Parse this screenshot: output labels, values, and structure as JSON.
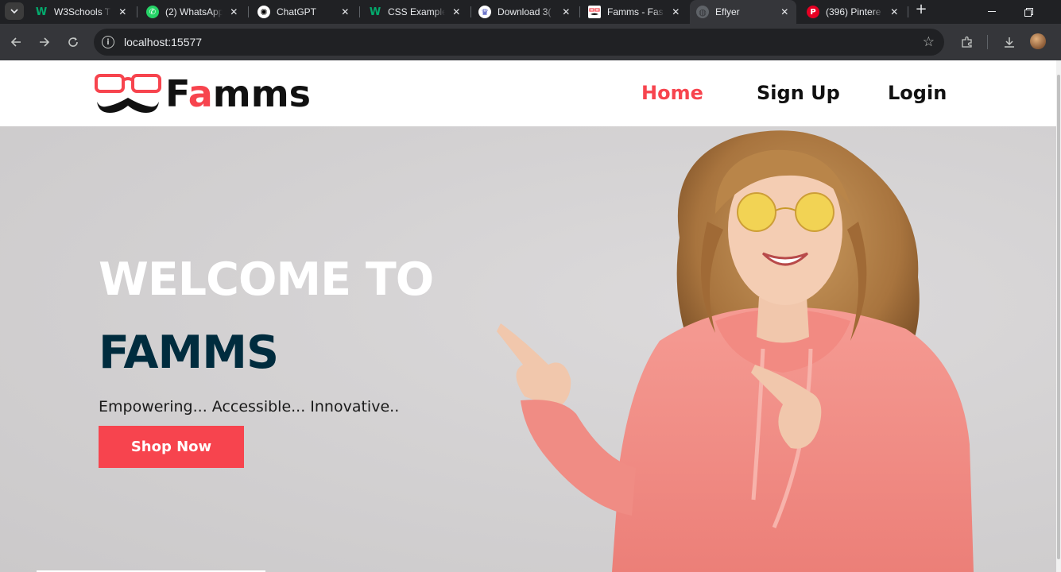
{
  "browser": {
    "tabs": [
      {
        "title": "W3Schools T",
        "favicon_color": "#04aa6d",
        "favicon_glyph": "W"
      },
      {
        "title": "(2) WhatsApp",
        "favicon_color": "#25d366",
        "favicon_glyph": "✆"
      },
      {
        "title": "ChatGPT",
        "favicon_color": "#ffffff",
        "favicon_glyph": "✺"
      },
      {
        "title": "CSS Example",
        "favicon_color": "#04aa6d",
        "favicon_glyph": "W"
      },
      {
        "title": "Download 3(",
        "favicon_color": "#5b5fc7",
        "favicon_glyph": "♛"
      },
      {
        "title": "Famms - Fas",
        "favicon_color": "#f7444e",
        "favicon_glyph": "◡"
      },
      {
        "title": "Eflyer",
        "favicon_color": "#5f6368",
        "favicon_glyph": "◍"
      },
      {
        "title": "(396) Pintere",
        "favicon_color": "#e60023",
        "favicon_glyph": "P"
      }
    ],
    "active_tab_index": 6,
    "url": "localhost:15577"
  },
  "site": {
    "logo": {
      "letters": [
        "F",
        "a",
        "mms"
      ],
      "accent_color": "#f7444e"
    },
    "nav": [
      {
        "label": "Home",
        "active": true
      },
      {
        "label": "Sign Up",
        "active": false
      },
      {
        "label": "Login",
        "active": false
      }
    ],
    "hero": {
      "line1": "WELCOME TO",
      "line2": "FAMMS",
      "tagline": "Empowering... Accessible... Innovative..",
      "cta": "Shop Now"
    },
    "colors": {
      "accent": "#f7444e",
      "dark": "#002c3e"
    }
  }
}
